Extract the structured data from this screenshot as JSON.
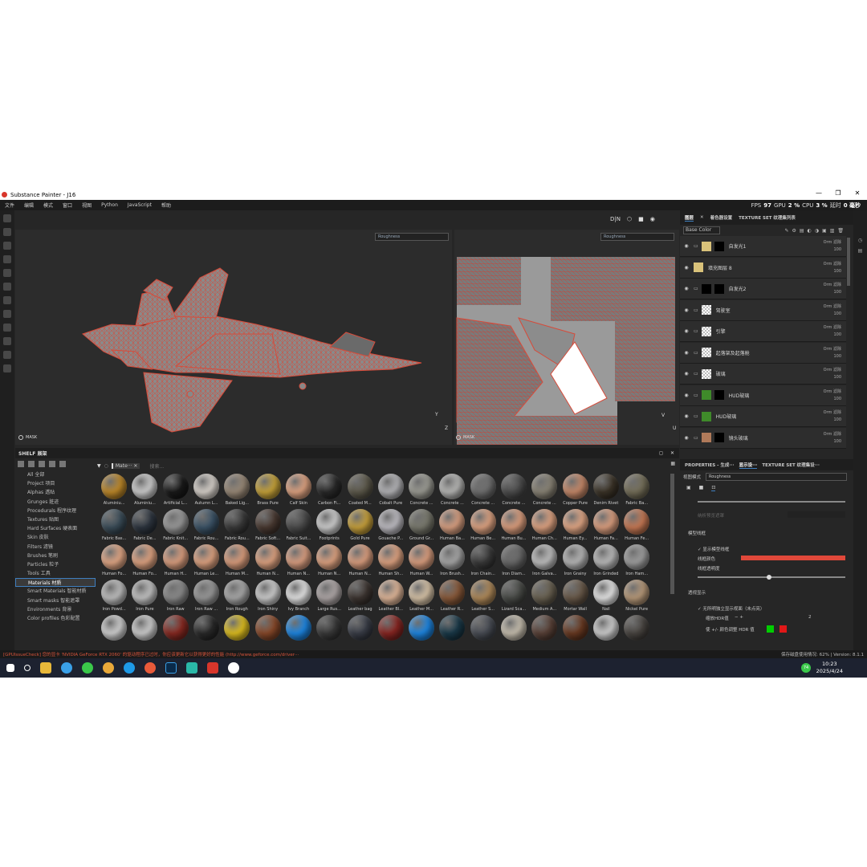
{
  "window": {
    "title": "Substance Painter - J16",
    "controls": [
      "—",
      "❐",
      "✕"
    ]
  },
  "menu": [
    "文件",
    "编辑",
    "模式",
    "窗口",
    "视图",
    "Python",
    "JavaScript",
    "帮助"
  ],
  "perf": {
    "fps_label": "FPS",
    "fps": "97",
    "gpu_label": "GPU",
    "gpu": "2 %",
    "cpu_label": "CPU",
    "cpu": "3 %",
    "latency_label": "延时",
    "latency": "0 毫秒"
  },
  "viewport_tools": [
    "D|N",
    "⬡",
    "■",
    "◉"
  ],
  "viewport3d": {
    "channel": "Roughness",
    "mask_label": "MASK",
    "axis_y": "Y",
    "axis_z": "Z"
  },
  "viewport2d": {
    "channel": "Roughness",
    "mask_label": "MASK",
    "axis_v": "V",
    "axis_u": "U"
  },
  "shelf": {
    "title": "SHELF 展架",
    "filter_tag": "Mate···",
    "search_placeholder": "搜索...",
    "categories": [
      "All 全部",
      "Project 项目",
      "Alphas 透贴",
      "Grunges 脏迹",
      "Procedurals 程序纹理",
      "Textures 贴图",
      "Hard Surfaces 硬表面",
      "Skin 皮肤",
      "Filters 滤镜",
      "Brushes 笔刷",
      "Particles 粒子",
      "Tools 工具",
      "Materials 材质",
      "Smart Materials 智能材质",
      "Smart masks 智能遮罩",
      "Environments 背景",
      "Color profiles 色彩配置"
    ],
    "selected_category": "Materials 材质",
    "materials": [
      {
        "name": "Aluminiu...",
        "color": "#c08a2a"
      },
      {
        "name": "Aluminiu...",
        "color": "#cfcfcf"
      },
      {
        "name": "Artificial L...",
        "color": "#1a1a1a"
      },
      {
        "name": "Autumn L...",
        "color": "#d9d3cc"
      },
      {
        "name": "Baked Lig...",
        "color": "#9a8a78"
      },
      {
        "name": "Brass Pure",
        "color": "#c8a43a"
      },
      {
        "name": "Calf Skin",
        "color": "#e0a482"
      },
      {
        "name": "Carbon Fi...",
        "color": "#2a2a2a"
      },
      {
        "name": "Coated M...",
        "color": "#5e5a4c"
      },
      {
        "name": "Cobalt Pure",
        "color": "#b5b5b8"
      },
      {
        "name": "Concrete ...",
        "color": "#9c9c94"
      },
      {
        "name": "Concrete ...",
        "color": "#b8b8b6"
      },
      {
        "name": "Concrete ...",
        "color": "#707070"
      },
      {
        "name": "Concrete ...",
        "color": "#4e4e4e"
      },
      {
        "name": "Concrete ...",
        "color": "#8a8476"
      },
      {
        "name": "Copper Pure",
        "color": "#c88a6a"
      },
      {
        "name": "Denim Rivet",
        "color": "#3c3428"
      },
      {
        "name": "Fabric Ba...",
        "color": "#76705a"
      },
      {
        "name": "Fabric Bas...",
        "color": "#3c4e5a"
      },
      {
        "name": "Fabric De...",
        "color": "#2e3640"
      },
      {
        "name": "Fabric Knit...",
        "color": "#9a9a9a"
      },
      {
        "name": "Fabric Rou...",
        "color": "#3c5468"
      },
      {
        "name": "Fabric Rou...",
        "color": "#3a3a3a"
      },
      {
        "name": "Fabric Soft...",
        "color": "#4a3a32"
      },
      {
        "name": "Fabric Suit...",
        "color": "#4c4c4c"
      },
      {
        "name": "Footprints",
        "color": "#d0d0d0"
      },
      {
        "name": "Gold Pure",
        "color": "#c9a23c"
      },
      {
        "name": "Gouache P...",
        "color": "#c0bec4"
      },
      {
        "name": "Ground Gr...",
        "color": "#7a7a6e"
      },
      {
        "name": "Human Ba...",
        "color": "#dba182"
      },
      {
        "name": "Human Be...",
        "color": "#e0a482"
      },
      {
        "name": "Human Bu...",
        "color": "#dd9f7e"
      },
      {
        "name": "Human Ch...",
        "color": "#e0a482"
      },
      {
        "name": "Human Ey...",
        "color": "#e3a886"
      },
      {
        "name": "Human Fa...",
        "color": "#dda080"
      },
      {
        "name": "Human Fe...",
        "color": "#c97a55"
      },
      {
        "name": "Human Fo...",
        "color": "#e3a886"
      },
      {
        "name": "Human Fo...",
        "color": "#e0a482"
      },
      {
        "name": "Human H...",
        "color": "#dda080"
      },
      {
        "name": "Human Le...",
        "color": "#e0a482"
      },
      {
        "name": "Human M...",
        "color": "#dd9f7e"
      },
      {
        "name": "Human N...",
        "color": "#e0a482"
      },
      {
        "name": "Human N...",
        "color": "#dca082"
      },
      {
        "name": "Human N...",
        "color": "#e0a482"
      },
      {
        "name": "Human N...",
        "color": "#dda080"
      },
      {
        "name": "Human Sh...",
        "color": "#e0a482"
      },
      {
        "name": "Human W...",
        "color": "#dda080"
      },
      {
        "name": "Iron Brush...",
        "color": "#a8a8a8"
      },
      {
        "name": "Iron Chain...",
        "color": "#3a3a3a"
      },
      {
        "name": "Iron Diam...",
        "color": "#6a6a6a"
      },
      {
        "name": "Iron Galva...",
        "color": "#c0c0c0"
      },
      {
        "name": "Iron Grainy",
        "color": "#b8b8b8"
      },
      {
        "name": "Iron Grinded",
        "color": "#bcbcbc"
      },
      {
        "name": "Iron Ham...",
        "color": "#a0a0a0"
      },
      {
        "name": "Iron Powd...",
        "color": "#c0c0c0"
      },
      {
        "name": "Iron Pure",
        "color": "#c4c4c4"
      },
      {
        "name": "Iron Raw",
        "color": "#8c8c8c"
      },
      {
        "name": "Iron Raw ...",
        "color": "#9a9a9a"
      },
      {
        "name": "Iron Rough",
        "color": "#aaaaaa"
      },
      {
        "name": "Iron Shiny",
        "color": "#cfcfcf"
      },
      {
        "name": "Ivy Branch",
        "color": "#e6e6e6"
      },
      {
        "name": "Large Rus...",
        "color": "#b0a8a8"
      },
      {
        "name": "Leather bag",
        "color": "#3e3632"
      },
      {
        "name": "Leather Bl...",
        "color": "#e2b89a"
      },
      {
        "name": "Leather M...",
        "color": "#d8c4a8"
      },
      {
        "name": "Leather R...",
        "color": "#8a5a3a"
      },
      {
        "name": "Leather S...",
        "color": "#b08a5a"
      },
      {
        "name": "Lizard Sca...",
        "color": "#4a4c48"
      },
      {
        "name": "Medium A...",
        "color": "#6a6252"
      },
      {
        "name": "Mortar Wall",
        "color": "#6a5a4a"
      },
      {
        "name": "Nail",
        "color": "#e8e8e8"
      },
      {
        "name": "Nickel Pure",
        "color": "#b89a7a"
      },
      {
        "name": "",
        "color": "#d2d2d2"
      },
      {
        "name": "",
        "color": "#cfcfcf"
      },
      {
        "name": "",
        "color": "#8a2a22"
      },
      {
        "name": "",
        "color": "#2a2a2a"
      },
      {
        "name": "",
        "color": "#e0c020"
      },
      {
        "name": "",
        "color": "#8a4a2a"
      },
      {
        "name": "",
        "color": "#1e88e5"
      },
      {
        "name": "",
        "color": "#3a3a3a"
      },
      {
        "name": "",
        "color": "#3a3e48"
      },
      {
        "name": "",
        "color": "#8a2622"
      },
      {
        "name": "",
        "color": "#1e88e5"
      },
      {
        "name": "",
        "color": "#1a3a4a"
      },
      {
        "name": "",
        "color": "#4a4e56"
      },
      {
        "name": "",
        "color": "#c8c0b0"
      },
      {
        "name": "",
        "color": "#5a4238"
      },
      {
        "name": "",
        "color": "#6a3a22"
      },
      {
        "name": "",
        "color": "#d0d0d0"
      },
      {
        "name": "",
        "color": "#4a4642"
      }
    ]
  },
  "right_tabs": [
    "图层",
    "着色器设置",
    "TEXTURE SET 纹理集列表"
  ],
  "channel_select": "Base Color",
  "layers": [
    {
      "name": "自发光1",
      "thumb": "#d9c27a",
      "mask": "#000000",
      "folder": true,
      "blend": "Orm 滤除",
      "opacity": "100"
    },
    {
      "name": "填充图层 8",
      "thumb": "#d9c27a",
      "mask": "",
      "folder": false,
      "blend": "Orm 滤除",
      "opacity": "100"
    },
    {
      "name": "自发光2",
      "thumb": "#000000",
      "mask": "#000000",
      "folder": true,
      "blend": "Orm 滤除",
      "opacity": "100"
    },
    {
      "name": "驾驶室",
      "thumb": "checker",
      "mask": "",
      "folder": true,
      "blend": "Orm 滤除",
      "opacity": "100"
    },
    {
      "name": "引擎",
      "thumb": "checker",
      "mask": "",
      "folder": true,
      "blend": "Orm 滤除",
      "opacity": "100"
    },
    {
      "name": "起落架及起落舱",
      "thumb": "checker",
      "mask": "",
      "folder": true,
      "blend": "Orm 滤除",
      "opacity": "100"
    },
    {
      "name": "玻璃",
      "thumb": "checker",
      "mask": "",
      "folder": true,
      "blend": "Orm 滤除",
      "opacity": "100"
    },
    {
      "name": "HUD玻璃",
      "thumb": "#3f8a2a",
      "mask": "#000000",
      "folder": true,
      "blend": "Orm 滤除",
      "opacity": "100"
    },
    {
      "name": "HUD玻璃",
      "thumb": "#3f8a2a",
      "mask": "",
      "folder": true,
      "blend": "Orm 滤除",
      "opacity": "100"
    },
    {
      "name": "镜头玻璃",
      "thumb": "#b07a5a",
      "mask": "#000000",
      "folder": true,
      "blend": "Orm 滤除",
      "opacity": "100"
    }
  ],
  "prop_tabs": [
    "PROPERTIES - 生成···",
    "显示设···",
    "TEXTURE SET 纹理集设···"
  ],
  "props": {
    "view_mode_label": "视图模式",
    "view_mode_value": "Roughness",
    "hidden_label": "纳析预览遮罩",
    "wireframe_section": "模型线框",
    "show_wireframe": "显示模型线框",
    "wire_color_label": "线框颜色",
    "wire_opacity_label": "线框透明度",
    "wire_color": "#e0483a",
    "transparency_section": "透视显示",
    "uv_option": "无所明独立显示视面（未点亮）",
    "hdr_label": "缩放HDR值",
    "hdr_value": "2",
    "color_adjust_label": "使 +/- 颜色调整 HDR 值",
    "swatch_green": "#00cc00",
    "swatch_red": "#e01818"
  },
  "status": {
    "error_text": "[GPUIssueCheck] 您的显卡 'NVIDIA GeForce RTX 2060' 的驱动程序已过时，你应该更新它以获得更好的性能 (http://www.geforce.com/driver···",
    "memory_label": "保存磁盘使用情况:",
    "memory_value": "62%",
    "version": "Version: 8.1.1"
  },
  "taskbar": {
    "time": "10:23",
    "date": "2025/4/24",
    "badge": "74"
  }
}
